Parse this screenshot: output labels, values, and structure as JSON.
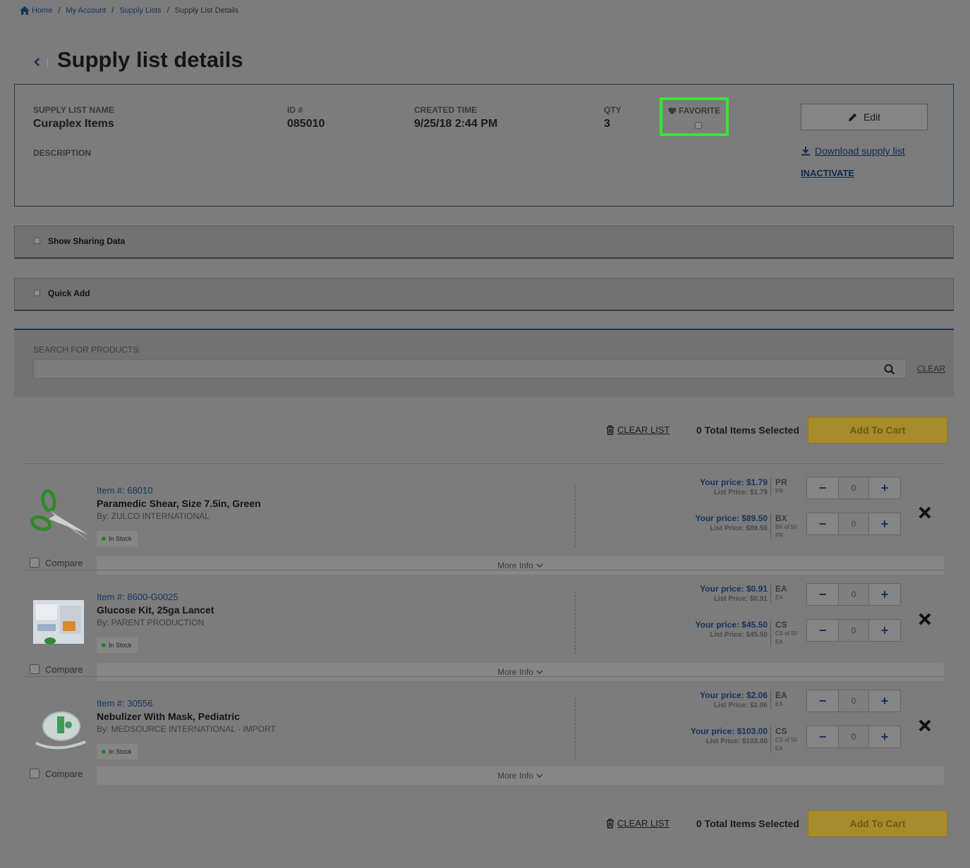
{
  "breadcrumb": {
    "home": "Home",
    "my_account": "My Account",
    "supply_lists": "Supply Lists",
    "current": "Supply List Details"
  },
  "page_title": "Supply list details",
  "list_info": {
    "name_label": "SUPPLY LIST NAME",
    "name_value": "Curaplex Items",
    "id_label": "ID #",
    "id_value": "085010",
    "created_label": "CREATED TIME",
    "created_value": "9/25/18 2:44 PM",
    "qty_label": "QTY",
    "qty_value": "3",
    "favorite_label": "FAVORITE",
    "description_label": "DESCRIPTION",
    "edit_label": "Edit",
    "download_label": "Download supply list",
    "inactivate_label": "INACTIVATE"
  },
  "toggles": {
    "sharing_label": "Show Sharing Data",
    "quick_add_label": "Quick Add"
  },
  "search": {
    "label": "SEARCH FOR PRODUCTS:",
    "value": "",
    "clear_label": "CLEAR"
  },
  "actions": {
    "clear_list_label": "CLEAR LIST",
    "total_selected": "0 Total Items Selected",
    "add_to_cart_label": "Add To Cart"
  },
  "products": [
    {
      "item_number": "Item #: 68010",
      "name": "Paramedic Shear, Size 7.5in, Green",
      "brand": "By: ZULCO INTERNATIONAL",
      "stock": "In Stock",
      "compare_label": "Compare",
      "more_info_label": "More Info",
      "units": [
        {
          "your_price": "Your price: $1.79",
          "list_price": "List Price: $1.79",
          "unit": "PR",
          "unit_sub1": "PR",
          "unit_sub2": "",
          "qty": "0"
        },
        {
          "your_price": "Your price: $89.50",
          "list_price": "List Price: $89.50",
          "unit": "BX",
          "unit_sub1": "BX of 50",
          "unit_sub2": "PR",
          "qty": "0"
        }
      ]
    },
    {
      "item_number": "Item #: 8600-G0025",
      "name": "Glucose Kit, 25ga Lancet",
      "brand": "By: PARENT PRODUCTION",
      "stock": "In Stock",
      "compare_label": "Compare",
      "more_info_label": "More Info",
      "units": [
        {
          "your_price": "Your price: $0.91",
          "list_price": "List Price: $0.91",
          "unit": "EA",
          "unit_sub1": "EA",
          "unit_sub2": "",
          "qty": "0"
        },
        {
          "your_price": "Your price: $45.50",
          "list_price": "List Price: $45.50",
          "unit": "CS",
          "unit_sub1": "CS of 50",
          "unit_sub2": "EA",
          "qty": "0"
        }
      ]
    },
    {
      "item_number": "Item #: 30556",
      "name": "Nebulizer With Mask, Pediatric",
      "brand": "By: MEDSOURCE INTERNATIONAL - IMPORT",
      "stock": "In Stock",
      "compare_label": "Compare",
      "more_info_label": "More Info",
      "units": [
        {
          "your_price": "Your price: $2.06",
          "list_price": "List Price: $2.06",
          "unit": "EA",
          "unit_sub1": "EA",
          "unit_sub2": "",
          "qty": "0"
        },
        {
          "your_price": "Your price: $103.00",
          "list_price": "List Price: $103.00",
          "unit": "CS",
          "unit_sub1": "CS of 50",
          "unit_sub2": "EA",
          "qty": "0"
        }
      ]
    }
  ],
  "icons": {
    "home": "home-icon",
    "back": "chevron-left-icon",
    "favorite": "heart-icon",
    "edit": "pencil-icon",
    "download": "download-icon",
    "search": "search-icon",
    "clear_list": "trash-icon",
    "remove": "close-icon",
    "more_info": "chevron-down-icon"
  },
  "colors": {
    "link": "#12345e",
    "highlight": "#39e631",
    "add_to_cart": "#a68b2a",
    "in_stock": "#1f8a1f"
  }
}
